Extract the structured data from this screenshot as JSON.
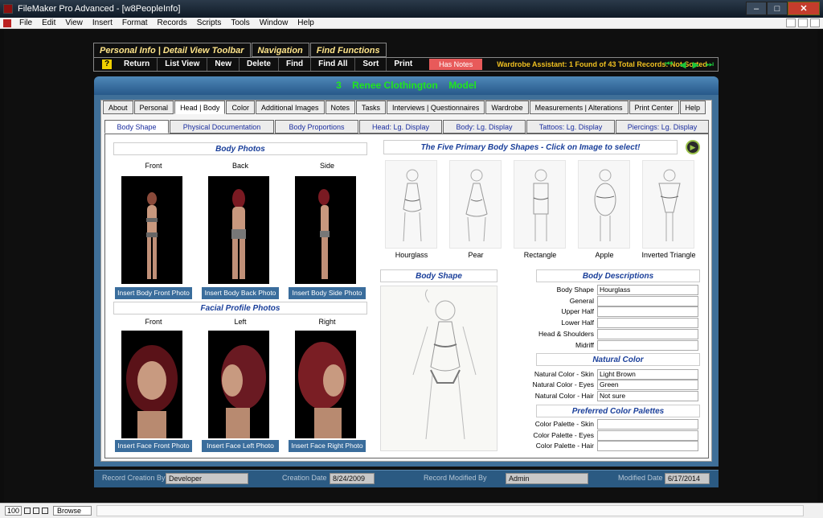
{
  "window": {
    "title": "FileMaker Pro Advanced - [w8PeopleInfo]",
    "controls": {
      "minimize": "–",
      "maximize": "□",
      "close": "✕"
    }
  },
  "menu": [
    "File",
    "Edit",
    "View",
    "Insert",
    "Format",
    "Records",
    "Scripts",
    "Tools",
    "Window",
    "Help"
  ],
  "toolbar": {
    "tabs": [
      "Personal Info | Detail View Toolbar",
      "Navigation",
      "Find Functions"
    ],
    "help_icon": "?",
    "buttons": [
      "Return",
      "List View",
      "New",
      "Delete",
      "Find",
      "Find All",
      "Sort",
      "Print"
    ],
    "has_notes": "Has Notes",
    "status": "Wardrobe Assistant: 1 Found of 43 Total Records: Not Sorted",
    "nav_icons": [
      "first-record-icon",
      "prev-record-icon",
      "next-record-icon",
      "last-record-icon"
    ]
  },
  "record": {
    "number": "3",
    "name": "Renee Clothington",
    "role": "Model"
  },
  "main_tabs": [
    "About",
    "Personal",
    "Head | Body",
    "Color",
    "Additional Images",
    "Notes",
    "Tasks",
    "Interviews | Questionnaires",
    "Wardrobe",
    "Measurements | Alterations",
    "Print Center",
    "Help"
  ],
  "sub_tabs": [
    "Body Shape",
    "Physical Documentation",
    "Body Proportions",
    "Head: Lg. Display",
    "Body: Lg. Display",
    "Tattoos: Lg. Display",
    "Piercings: Lg. Display"
  ],
  "body_photos": {
    "title": "Body Photos",
    "labels": [
      "Front",
      "Back",
      "Side"
    ],
    "buttons": [
      "Insert Body Front Photo",
      "Insert Body Back Photo",
      "Insert Body Side Photo"
    ]
  },
  "facial_photos": {
    "title": "Facial Profile Photos",
    "labels": [
      "Front",
      "Left",
      "Right"
    ],
    "buttons": [
      "Insert Face Front Photo",
      "Insert Face Left Photo",
      "Insert Face Right Photo"
    ]
  },
  "shapes": {
    "title": "The Five Primary Body Shapes - Click on Image to select!",
    "items": [
      "Hourglass",
      "Pear",
      "Rectangle",
      "Apple",
      "Inverted Triangle"
    ]
  },
  "body_shape_preview": {
    "title": "Body Shape"
  },
  "body_descriptions": {
    "title": "Body Descriptions",
    "fields": [
      {
        "label": "Body Shape",
        "value": "Hourglass"
      },
      {
        "label": "General",
        "value": ""
      },
      {
        "label": "Upper Half",
        "value": ""
      },
      {
        "label": "Lower Half",
        "value": ""
      },
      {
        "label": "Head & Shoulders",
        "value": ""
      },
      {
        "label": "Midriff",
        "value": ""
      }
    ]
  },
  "natural_color": {
    "title": "Natural Color",
    "fields": [
      {
        "label": "Natural Color - Skin",
        "value": "Light Brown"
      },
      {
        "label": "Natural Color - Eyes",
        "value": "Green"
      },
      {
        "label": "Natural Color - Hair",
        "value": "Not sure"
      }
    ]
  },
  "palettes": {
    "title": "Preferred Color Palettes",
    "fields": [
      {
        "label": "Color Palette - Skin",
        "value": ""
      },
      {
        "label": "Color Palette - Eyes",
        "value": ""
      },
      {
        "label": "Color Palette - Hair",
        "value": ""
      }
    ]
  },
  "footer": {
    "created_by_label": "Record Creation By",
    "created_by": "Developer",
    "creation_date_label": "Creation Date",
    "creation_date": "8/24/2009",
    "modified_by_label": "Record Modified By",
    "modified_by": "Admin",
    "modified_date_label": "Modified Date",
    "modified_date": "6/17/2014"
  },
  "status_bar": {
    "zoom": "100",
    "mode": "Browse"
  },
  "colors": {
    "accent_green": "#20e520",
    "panel_blue": "#3f6f98",
    "notes_red": "#e85a5a",
    "status_yellow": "#f0c020"
  }
}
